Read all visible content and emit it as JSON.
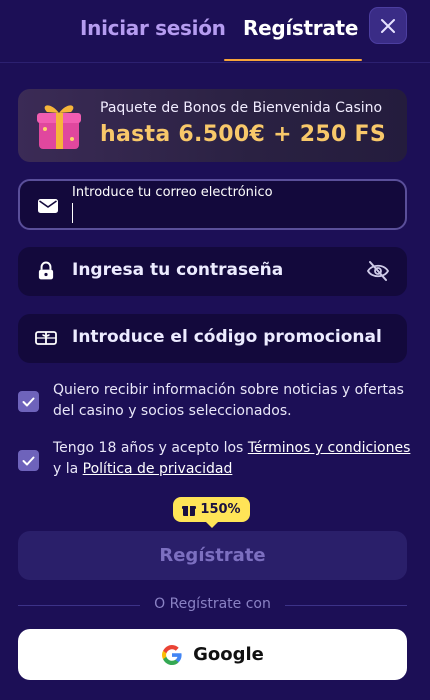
{
  "header": {
    "login_tab": "Iniciar sesión",
    "register_tab": "Regístrate",
    "close_icon": "close-icon"
  },
  "bonus": {
    "title": "Paquete de Bonos de Bienvenida Casino",
    "amount": "hasta 6.500€ + 250 FS"
  },
  "form": {
    "email_label": "Introduce tu correo electrónico",
    "email_value": "",
    "password_placeholder": "Ingresa tu contraseña",
    "promo_placeholder": "Introduce el código promocional"
  },
  "consents": {
    "newsletter": "Quiero recibir información sobre noticias y ofertas del casino y socios seleccionados.",
    "terms_prefix": "Tengo 18 años y acepto los ",
    "terms_link": "Términos y condiciones",
    "terms_mid": " y la ",
    "privacy_link": "Política de privacidad",
    "newsletter_checked": true,
    "terms_checked": true
  },
  "promo_badge": "150%",
  "submit_label": "Regístrate",
  "divider_text": "O Regístrate con",
  "google_label": "Google",
  "colors": {
    "background": "#1c0f56",
    "accent": "#f7a43a",
    "badge": "#ffe457",
    "bonus_amount": "#f8c86a"
  }
}
